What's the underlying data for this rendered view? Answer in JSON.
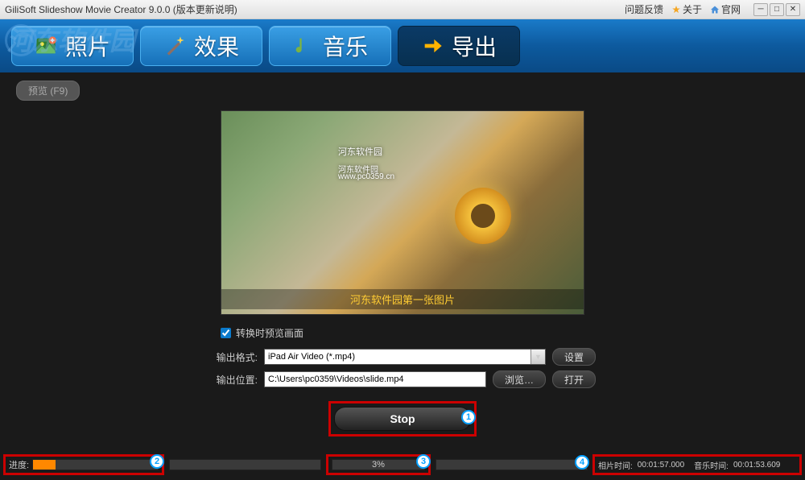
{
  "titlebar": {
    "title": "GiliSoft Slideshow Movie Creator 9.0.0 (版本更新说明)",
    "feedback": "问题反馈",
    "about": "关于",
    "home": "官网"
  },
  "nav": {
    "tabs": [
      {
        "label": "照片"
      },
      {
        "label": "效果"
      },
      {
        "label": "音乐"
      },
      {
        "label": "导出"
      }
    ]
  },
  "preview_btn": "预览 (F9)",
  "video": {
    "wm1": "河东软件园",
    "wm2": "河东软件园",
    "wm3": "www.pc0359.cn",
    "caption": "河东软件园第一张图片"
  },
  "form": {
    "preview_checkbox": "转换时预览画面",
    "format_label": "输出格式:",
    "format_value": "iPad Air Video (*.mp4)",
    "settings_btn": "设置",
    "location_label": "输出位置:",
    "location_value": "C:\\Users\\pc0359\\Videos\\slide.mp4",
    "browse_btn": "浏览…",
    "open_btn": "打开"
  },
  "stop_btn": "Stop",
  "progress": {
    "label": "进度:",
    "percent": "3%",
    "percent_width": "3%",
    "photo_time_label": "相片时间:",
    "photo_time": "00:01:57.000",
    "music_time_label": "音乐时间:",
    "music_time": "00:01:53.609"
  },
  "watermark": "河东软件园",
  "hints": {
    "h1": "1",
    "h2": "2",
    "h3": "3",
    "h4": "4"
  }
}
